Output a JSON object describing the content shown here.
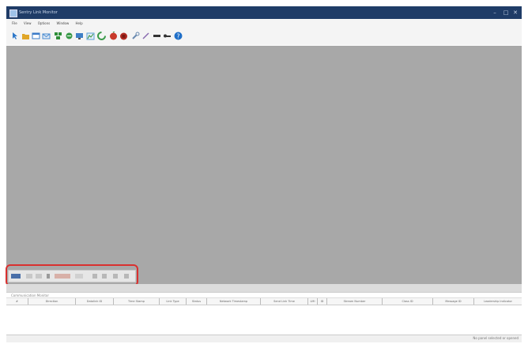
{
  "window": {
    "title": "Sentry Link Monitor",
    "minimize": "–",
    "maximize": "□",
    "close": "✕"
  },
  "menu": [
    "File",
    "View",
    "Options",
    "Window",
    "Help"
  ],
  "toolbar_icons": [
    {
      "name": "select-icon",
      "color": "#2e78c8"
    },
    {
      "name": "open-icon",
      "color": "#e0a628"
    },
    {
      "name": "window-icon",
      "color": "#3a7bc8"
    },
    {
      "name": "mail-icon",
      "color": "#4a8cd0"
    },
    {
      "name": "network-icon",
      "color": "#2f8f3a"
    },
    {
      "name": "connect-icon",
      "color": "#3a9a4a"
    },
    {
      "name": "monitor-icon",
      "color": "#3f7fc6"
    },
    {
      "name": "chart-icon",
      "color": "#5a9fd4"
    },
    {
      "name": "recycle-icon",
      "color": "#3a9a4a"
    },
    {
      "name": "record-icon",
      "color": "#c83a2a"
    },
    {
      "name": "stop-icon",
      "color": "#b02a22"
    },
    {
      "name": "wrench-icon",
      "color": "#6a8ab0"
    },
    {
      "name": "pen-icon",
      "color": "#8a6ab0"
    },
    {
      "name": "link-icon",
      "color": "#333333"
    },
    {
      "name": "key-icon",
      "color": "#333333"
    },
    {
      "name": "help-icon",
      "color": "#1f6fc8"
    }
  ],
  "panel": {
    "title": "Communication Monitor",
    "columns": [
      "#",
      "Direction",
      "Datalink ID",
      "Time Stamp",
      "Link Type",
      "Status",
      "Network Timestamp",
      "Send Link Time",
      "LMI",
      "ID",
      "Stream Number",
      "Class ID",
      "Message ID",
      "Leadership Indicator"
    ]
  },
  "statusbar": {
    "text": "No panel selected or opened"
  },
  "colors": {
    "titlebar": "#1f3c67",
    "workspace": "#a8a8a8",
    "highlight": "#d9302f"
  }
}
